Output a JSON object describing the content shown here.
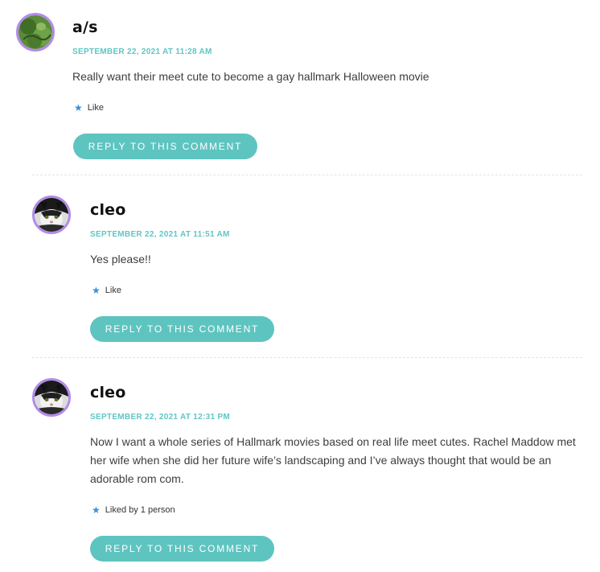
{
  "comments": [
    {
      "author": "a/s",
      "date": "SEPTEMBER 22, 2021 AT 11:28 AM",
      "text": "Really want their meet cute to become a gay hallmark Halloween movie",
      "like_label": "Like",
      "reply_label": "REPLY TO THIS COMMENT",
      "avatar_icon": "green-bird-avatar"
    },
    {
      "author": "cleo",
      "date": "SEPTEMBER 22, 2021 AT 11:51 AM",
      "text": "Yes please!!",
      "like_label": "Like",
      "reply_label": "REPLY TO THIS COMMENT",
      "avatar_icon": "black-white-cat-avatar"
    },
    {
      "author": "cleo",
      "date": "SEPTEMBER 22, 2021 AT 12:31 PM",
      "text": "Now I want a whole series of Hallmark movies based on real life meet cutes. Rachel Maddow met her wife when she did her future wife’s landscaping and I’ve always thought that would be an adorable rom com.",
      "like_label": "Liked by 1 person",
      "reply_label": "REPLY TO THIS COMMENT",
      "avatar_icon": "black-white-cat-avatar"
    }
  ],
  "colors": {
    "accent": "#5ec4c0",
    "date": "#5fc6c4",
    "avatar_border": "#b28be8",
    "star": "#3a8fd6"
  },
  "icons": {
    "like": "star-icon"
  }
}
